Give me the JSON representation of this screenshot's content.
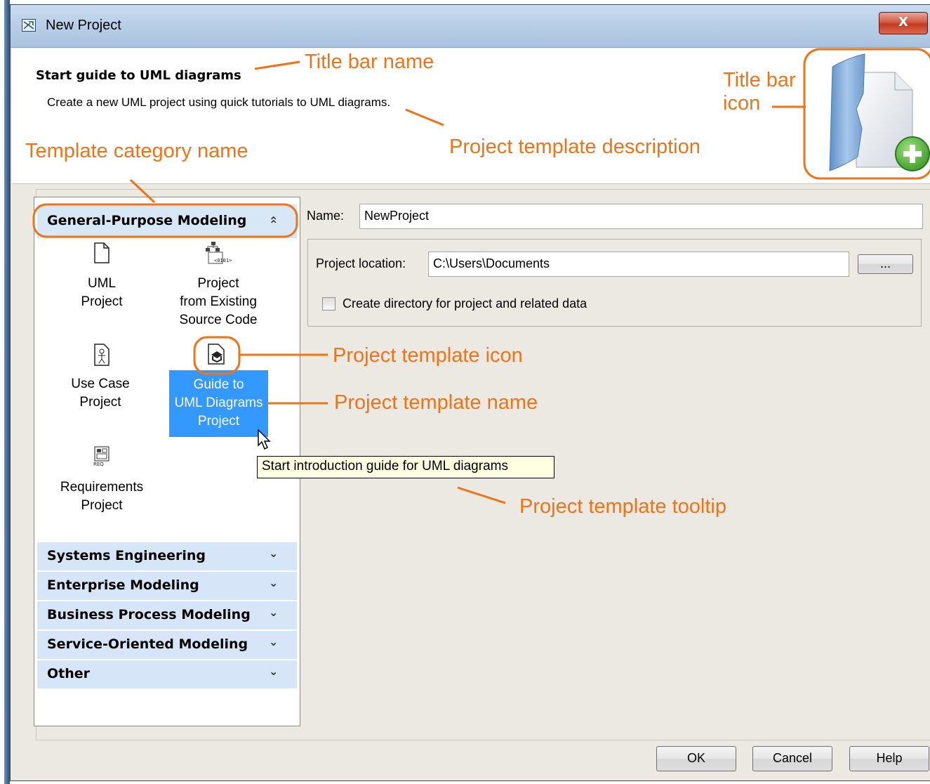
{
  "window": {
    "title": "New Project",
    "close_label": "X"
  },
  "header": {
    "title": "Start guide to UML diagrams",
    "description": "Create a new UML project using quick tutorials to UML diagrams."
  },
  "categories": {
    "expanded": {
      "label": "General-Purpose Modeling",
      "chevron": "collapse-chevrons-icon"
    },
    "collapsed": [
      {
        "label": "Systems Engineering"
      },
      {
        "label": "Enterprise Modeling"
      },
      {
        "label": "Business Process Modeling"
      },
      {
        "label": "Service-Oriented Modeling"
      },
      {
        "label": "Other"
      }
    ]
  },
  "templates": [
    {
      "label_lines": [
        "UML",
        "Project"
      ],
      "icon": "blank-document-icon"
    },
    {
      "label_lines": [
        "Project",
        "from Existing",
        "Source Code"
      ],
      "icon": "source-code-icon"
    },
    {
      "label_lines": [
        "Use Case",
        "Project"
      ],
      "icon": "use-case-icon"
    },
    {
      "label_lines": [
        "Guide to",
        "UML Diagrams",
        "Project"
      ],
      "icon": "guide-icon",
      "selected": true
    },
    {
      "label_lines": [
        "Requirements",
        "Project"
      ],
      "icon": "requirements-icon"
    }
  ],
  "form": {
    "name_label": "Name:",
    "name_value": "NewProject",
    "location_label": "Project location:",
    "location_value": "C:\\Users\\Documents",
    "browse_label": "...",
    "create_dir_label": "Create directory for project and related data",
    "create_dir_checked": false
  },
  "tooltip": "Start introduction guide for UML diagrams",
  "buttons": {
    "ok": "OK",
    "cancel": "Cancel",
    "help": "Help"
  },
  "annotations": {
    "title_bar_name": "Title bar name",
    "title_bar_icon_line1": "Title bar",
    "title_bar_icon_line2": "icon",
    "template_description": "Project template description",
    "category_name": "Template category name",
    "template_icon": "Project template icon",
    "template_name": "Project template name",
    "template_tooltip": "Project template tooltip"
  },
  "colors": {
    "annotation": "#f07318",
    "selection": "#3399ff",
    "category_bg": "#d6e6f8",
    "tooltip_bg": "#ffffe1"
  }
}
